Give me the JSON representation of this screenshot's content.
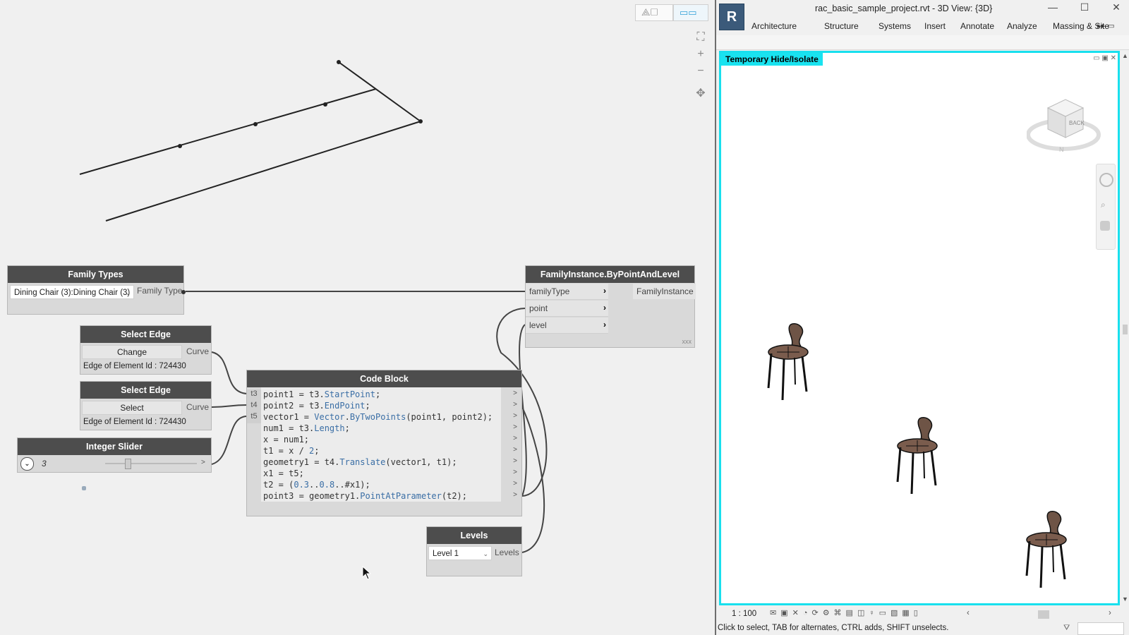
{
  "dynamo": {
    "nodes": {
      "family_types": {
        "title": "Family Types",
        "selected": "Dining Chair (3):Dining Chair (3)",
        "output": "Family Type"
      },
      "select_edge_1": {
        "title": "Select Edge",
        "button": "Change",
        "output": "Curve",
        "info": "Edge of Element Id : 724430"
      },
      "select_edge_2": {
        "title": "Select Edge",
        "button": "Select",
        "output": "Curve",
        "info": "Edge of Element Id : 724430"
      },
      "integer_slider": {
        "title": "Integer Slider",
        "value": "3"
      },
      "code_block": {
        "title": "Code Block",
        "inputs": [
          "t3",
          "t4",
          "t5"
        ]
      },
      "family_instance": {
        "title": "FamilyInstance.ByPointAndLevel",
        "inputs": [
          "familyType",
          "point",
          "level"
        ],
        "output": "FamilyInstance",
        "footer": "xxx"
      },
      "levels": {
        "title": "Levels",
        "selected": "Level 1",
        "output": "Levels"
      }
    }
  },
  "revit": {
    "title": "rac_basic_sample_project.rvt - 3D View: {3D}",
    "tabs": [
      "Architecture",
      "Structure",
      "Systems",
      "Insert",
      "Annotate",
      "Analyze",
      "Massing & Site"
    ],
    "temporary_label": "Temporary Hide/Isolate",
    "viewcube_face": "BACK",
    "scale": "1 : 100",
    "status": "Click to select, TAB for alternates, CTRL adds, SHIFT unselects."
  }
}
